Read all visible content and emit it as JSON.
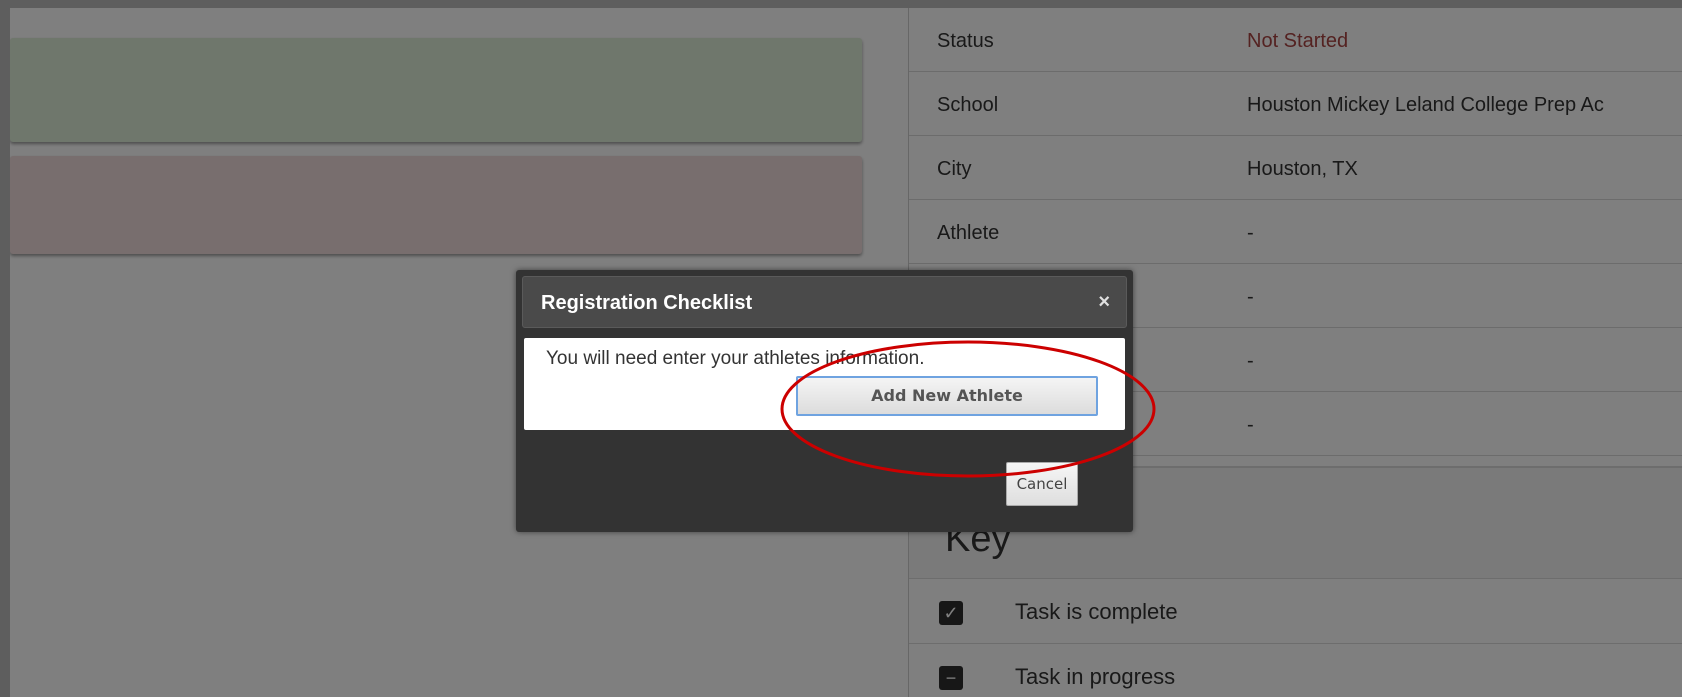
{
  "info": {
    "rows": [
      {
        "key": "Status",
        "value": "Not Started"
      },
      {
        "key": "School",
        "value": "Houston Mickey Leland College Prep Ac"
      },
      {
        "key": "City",
        "value": "Houston, TX"
      },
      {
        "key": "Athlete",
        "value": "-"
      },
      {
        "key": "",
        "value": "-"
      },
      {
        "key": "",
        "value": "-"
      },
      {
        "key": "",
        "value": "-"
      }
    ]
  },
  "key": {
    "title": "Key",
    "items": [
      {
        "icon": "check-icon",
        "label": "Task is complete"
      },
      {
        "icon": "minus-icon",
        "label": "Task in progress"
      }
    ]
  },
  "dialog": {
    "title": "Registration Checklist",
    "close_glyph": "×",
    "message": "You will need enter your athletes information.",
    "add_button": "Add New Athlete",
    "cancel_button": "Cancel"
  },
  "colors": {
    "status_not_started": "#a94442",
    "annotation": "#cc0000"
  }
}
